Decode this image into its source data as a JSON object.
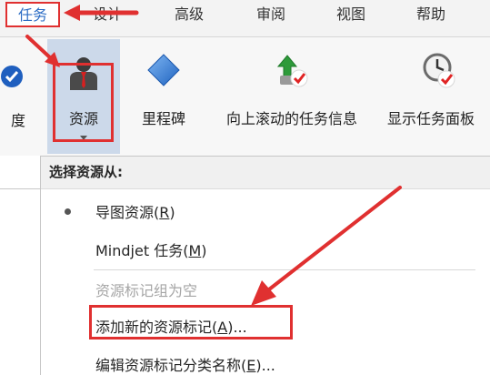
{
  "tabs": [
    {
      "label": "任务",
      "active": true
    },
    {
      "label": "设计"
    },
    {
      "label": "高级"
    },
    {
      "label": "审阅"
    },
    {
      "label": "视图"
    },
    {
      "label": "帮助"
    }
  ],
  "ribbon": {
    "partial_left_label": "度",
    "resource_label": "资源",
    "milestone_label": "里程碑",
    "scroll_to_task_label": "向上滚动的任务信息",
    "show_task_panel_label": "显示任务面板"
  },
  "dropdown": {
    "header": "选择资源从:",
    "items": [
      {
        "label": "导图资源(",
        "key": "R",
        "suffix": ")",
        "checked": true
      },
      {
        "label": "Mindjet  任务(",
        "key": "M",
        "suffix": ")"
      },
      {
        "label": "资源标记组为空",
        "disabled": true
      },
      {
        "label": "添加新的资源标记(",
        "key": "A",
        "suffix": ")..."
      },
      {
        "label": "编辑资源标记分类名称(",
        "key": "E",
        "suffix": ")..."
      }
    ]
  },
  "colors": {
    "accent_blue": "#2b6cc4",
    "highlight_red": "#e03030",
    "selected_button_bg": "#ccd9ea"
  }
}
